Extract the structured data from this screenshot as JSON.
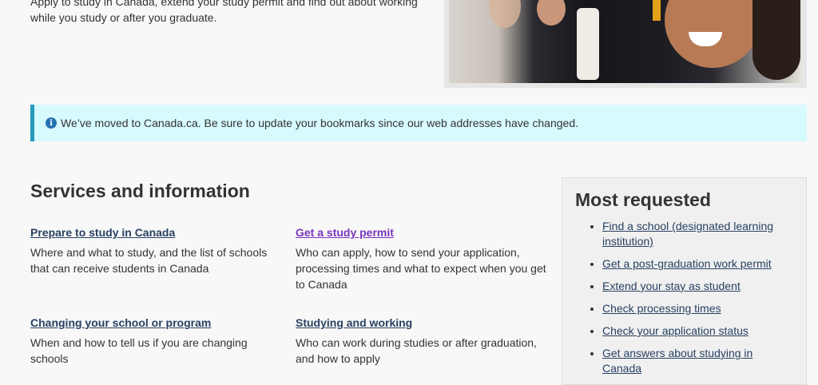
{
  "intro": {
    "line1": "Apply to study in Canada, extend your study permit and find out about working",
    "line2": "while you study or after you graduate."
  },
  "hero": {
    "image": "graduates-photo"
  },
  "alert": {
    "icon": "info-icon",
    "icon_glyph": "i",
    "text": "We’ve moved to Canada.ca. Be sure to update your bookmarks since our web addresses have changed."
  },
  "services": {
    "heading": "Services and information",
    "items": [
      {
        "title": "Prepare to study in Canada",
        "desc": "Where and what to study, and the list of schools that can receive students in Canada"
      },
      {
        "title": "Get a study permit",
        "desc": "Who can apply, how to send your application, processing times and what to expect when you get to Canada"
      },
      {
        "title": "Changing your school or program",
        "desc": "When and how to tell us if you are changing schools"
      },
      {
        "title": "Studying and working",
        "desc": "Who can work during studies or after graduation, and how to apply"
      }
    ]
  },
  "most_requested": {
    "heading": "Most requested",
    "links": [
      "Find a  school (designated learning institution)",
      "Get a post-graduation work permit",
      "Extend your stay as student",
      "Check processing times",
      "Check your application status",
      "Get answers about studying in Canada"
    ]
  },
  "colors": {
    "link": "#284162",
    "visited_link": "#7834bc",
    "alert_bg": "#d7faff",
    "alert_border": "#269abc"
  }
}
